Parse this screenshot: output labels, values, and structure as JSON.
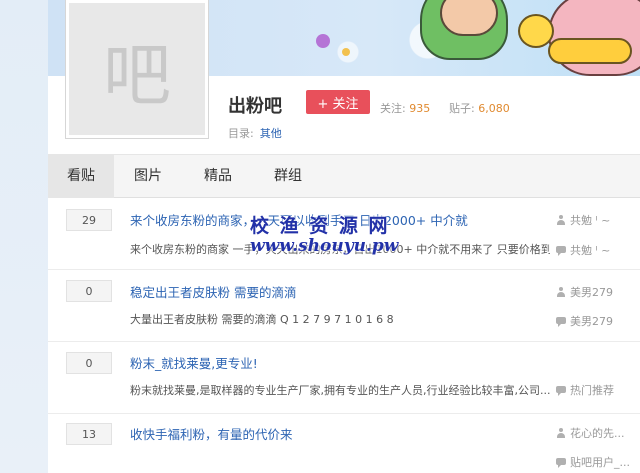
{
  "forum": {
    "logo_char": "吧",
    "name": "出粉吧",
    "follow_label": "+ 关注",
    "follow_count_label": "关注:",
    "follow_count": "935",
    "post_count_label": "贴子:",
    "post_count": "6,080",
    "dir_label": "目录:",
    "dir_value": "其他"
  },
  "tabs": [
    {
      "label": "看贴"
    },
    {
      "label": "图片"
    },
    {
      "label": "精品"
    },
    {
      "label": "群组"
    }
  ],
  "threads": [
    {
      "replies": "29",
      "title": "来个收房东粉的商家，一天可以收到手五 日出2000+ 中介就",
      "abstract": "来个收房东粉的商家 一手，天天出来的房东，日出1000+ 中介就不用来了 只要价格到位 质...",
      "author": "共勉 ᑊ ~",
      "last_reply": "共勉 ᑊ ~"
    },
    {
      "replies": "0",
      "title": "稳定出王者皮肤粉 需要的滴滴",
      "abstract": "大量出王者皮肤粉 需要的滴滴 Q 1 2 7 9 7 1 0 1 6 8",
      "author": "美男279",
      "last_reply": "美男279"
    },
    {
      "replies": "0",
      "title": "粉末_就找莱曼,更专业!",
      "abstract": "粉末就找莱曼,是取样器的专业生产厂家,拥有专业的生产人员,行业经验比较丰富,公司...",
      "author": "",
      "last_reply": "热门推荐"
    },
    {
      "replies": "13",
      "title": "收快手福利粉，有量的代价来",
      "abstract": "",
      "author": "花心的先...",
      "last_reply": "贴吧用户_..."
    }
  ],
  "watermark": {
    "line1": "校 渔 资 源 网",
    "line2": "www.shouyu.pw"
  },
  "colors": {
    "link_blue": "#2d64b3",
    "follow_red": "#e8505b",
    "count_orange": "#e08a30"
  }
}
